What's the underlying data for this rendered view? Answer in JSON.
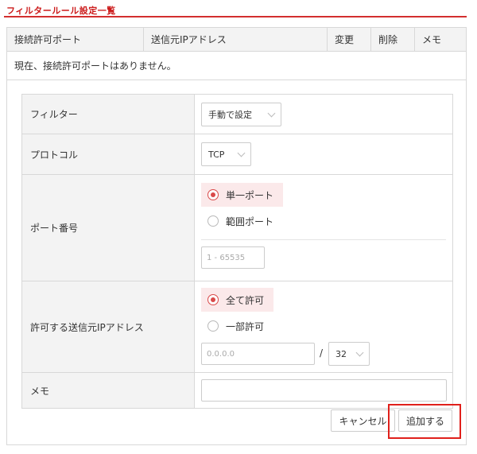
{
  "page": {
    "title": "フィルタールール設定一覧"
  },
  "summary": {
    "columns": [
      "接続許可ポート",
      "送信元IPアドレス",
      "変更",
      "削除",
      "メモ"
    ],
    "empty_message": "現在、接続許可ポートはありません。"
  },
  "form": {
    "filter": {
      "label": "フィルター",
      "value": "手動で設定"
    },
    "protocol": {
      "label": "プロトコル",
      "value": "TCP"
    },
    "port": {
      "label": "ポート番号",
      "option_single": "単一ポート",
      "option_range": "範囲ポート",
      "selected": "単一ポート",
      "input_placeholder": "1 - 65535"
    },
    "source_ip": {
      "label": "許可する送信元IPアドレス",
      "option_all": "全て許可",
      "option_partial": "一部許可",
      "selected": "全て許可",
      "ip_placeholder": "0.0.0.0",
      "slash": "/",
      "mask_value": "32"
    },
    "memo": {
      "label": "メモ",
      "value": ""
    }
  },
  "buttons": {
    "cancel": "キャンセル",
    "add": "追加する"
  },
  "colors": {
    "accent": "#d32f2f",
    "radio_selected_bg": "#fbe9ea",
    "highlight": "#e0201b"
  }
}
